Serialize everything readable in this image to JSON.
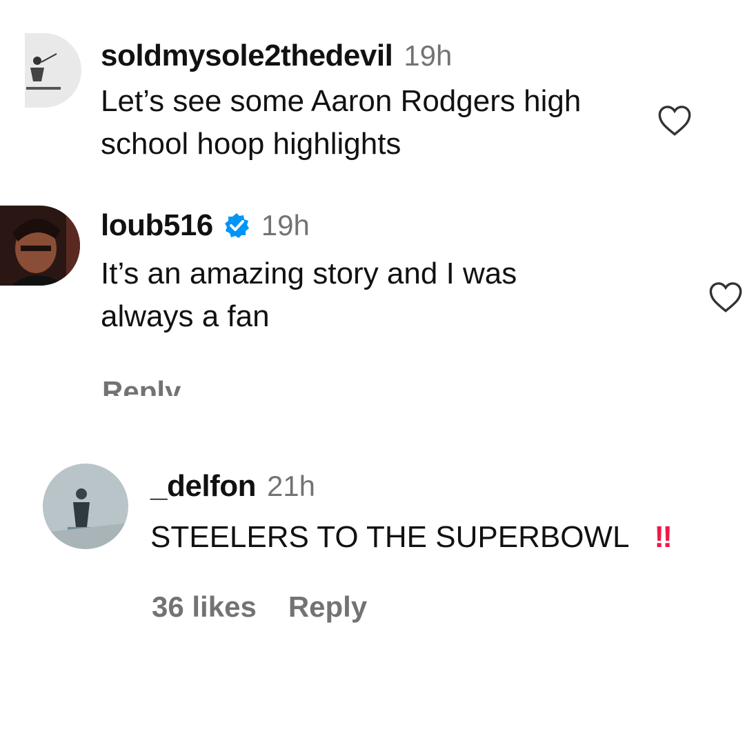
{
  "comments": [
    {
      "username": "soldmysole2thedevil",
      "time": "19h",
      "text_lines": [
        "Let’s see some Aaron Rodgers high",
        "school hoop highlights"
      ],
      "avatar_icon": "user-avatar-icon",
      "like_icon": "heart-outline-icon"
    },
    {
      "username": "loub516",
      "verified": true,
      "time": "19h",
      "text_lines": [
        "It’s an amazing story and I was",
        "always a fan"
      ],
      "reply_label": "Reply",
      "avatar_icon": "user-avatar-icon",
      "like_icon": "heart-outline-icon"
    },
    {
      "username": "_delfon",
      "time": "21h",
      "text": "STEELERS TO THE SUPERBOWL",
      "emoji": "‼",
      "likes": "36 likes",
      "reply_label": "Reply",
      "avatar_icon": "user-avatar-icon"
    }
  ],
  "colors": {
    "text": "#111111",
    "muted": "#737373",
    "verified_blue": "#0095f6",
    "emoji_red": "#ed1b4a"
  }
}
